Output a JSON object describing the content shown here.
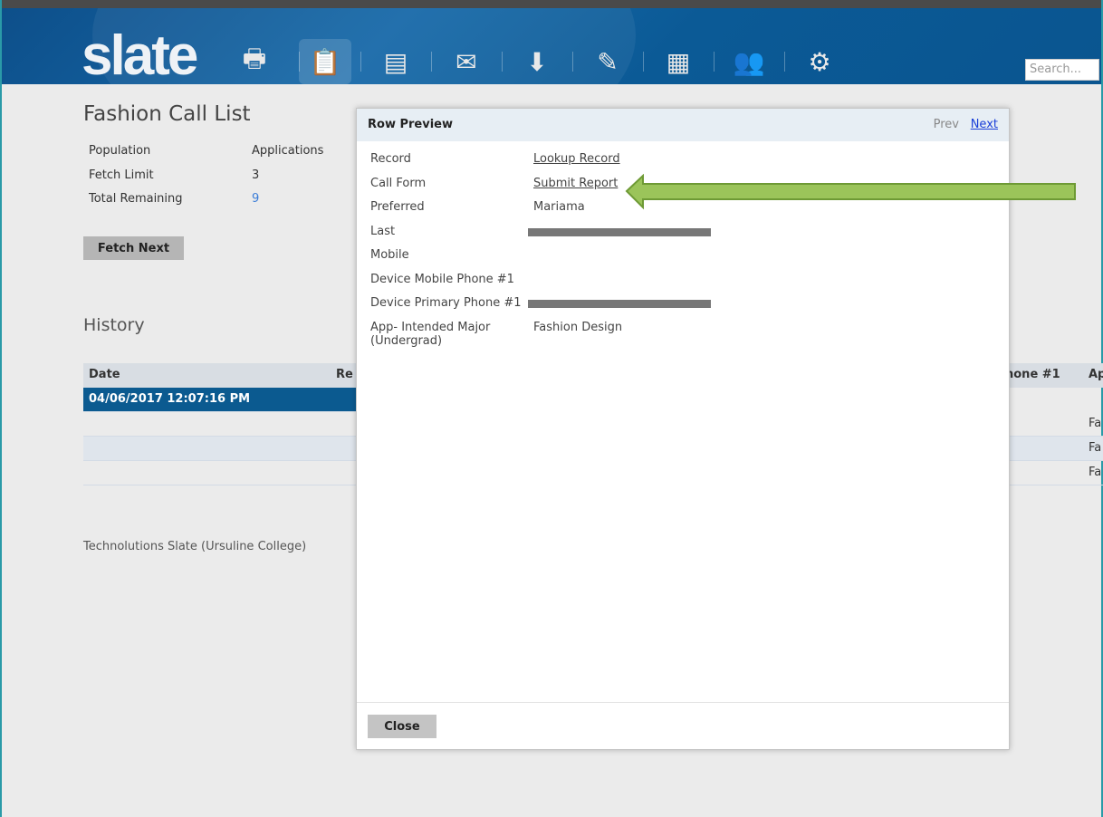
{
  "app": {
    "logo": "slate",
    "search_placeholder": "Search...",
    "nav_icons": [
      "print-icon",
      "queries-icon",
      "forms-icon",
      "mail-icon",
      "inbox-download-icon",
      "reader-icon",
      "calendar-icon",
      "users-icon",
      "gear-icon"
    ]
  },
  "page": {
    "title": "Fashion Call List",
    "stats": [
      {
        "label": "Population",
        "value": "Applications"
      },
      {
        "label": "Fetch Limit",
        "value": "3"
      },
      {
        "label": "Total Remaining",
        "value": "9"
      }
    ],
    "fetch_next": "Fetch Next",
    "history_title": "History"
  },
  "history": {
    "columns": {
      "date": "Date",
      "record": "Re",
      "phone": "hone #1",
      "app": "Ap"
    },
    "rows": [
      {
        "date": "04/06/2017 12:07:16 PM",
        "app": ""
      },
      {
        "date": "",
        "app": "Fa"
      },
      {
        "date": "",
        "app": "Fa"
      },
      {
        "date": "",
        "app": "Fa"
      }
    ]
  },
  "footer": "Technolutions Slate (Ursuline College)",
  "modal": {
    "title": "Row Preview",
    "prev": "Prev",
    "next": "Next",
    "close": "Close",
    "fields": [
      {
        "label": "Record",
        "value": "Lookup Record",
        "type": "link"
      },
      {
        "label": "Call Form",
        "value": "Submit Report",
        "type": "link"
      },
      {
        "label": "Preferred",
        "value": "Mariama"
      },
      {
        "label": "Last",
        "value": "",
        "type": "redacted"
      },
      {
        "label": "Mobile",
        "value": ""
      },
      {
        "label": "Device Mobile Phone #1",
        "value": ""
      },
      {
        "label": "Device Primary Phone #1",
        "value": "",
        "type": "redacted"
      },
      {
        "label": "App- Intended Major (Undergrad)",
        "value": "Fashion Design"
      }
    ]
  },
  "colors": {
    "header": "#0b5a96",
    "selected_row": "#0b5a90",
    "link": "#3b2fe0",
    "arrow": "#9bc45a"
  }
}
